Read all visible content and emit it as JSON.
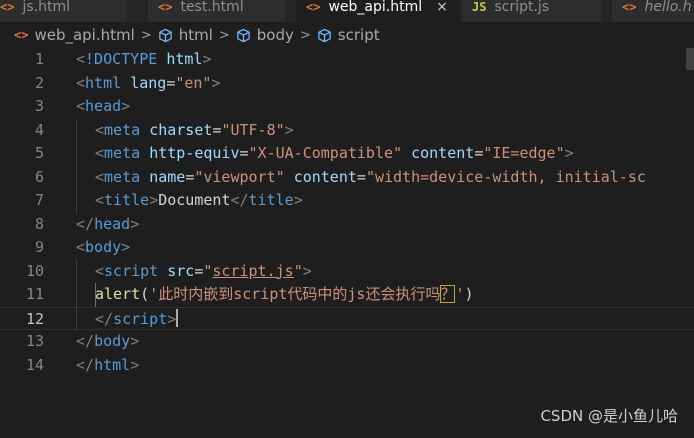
{
  "tabs": [
    {
      "icon": "<>",
      "label": "js.html"
    },
    {
      "icon": "<>",
      "label": "test.html"
    },
    {
      "icon": "<>",
      "label": "web_api.html",
      "close": "×"
    },
    {
      "icon": "JS",
      "label": "script.js"
    },
    {
      "icon": "<>",
      "label": "hello.h"
    }
  ],
  "breadcrumb": {
    "file": "web_api.html",
    "items": [
      "html",
      "body",
      "script"
    ],
    "separator": ">"
  },
  "editor": {
    "line_numbers": [
      "1",
      "2",
      "3",
      "4",
      "5",
      "6",
      "7",
      "8",
      "9",
      "10",
      "11",
      "12",
      "13",
      "14"
    ],
    "current_line": "12",
    "lines": [
      [
        [
          "punc",
          "<"
        ],
        [
          "tag",
          "!DOCTYPE"
        ],
        [
          "txt",
          " "
        ],
        [
          "attr",
          "html"
        ],
        [
          "punc",
          ">"
        ]
      ],
      [
        [
          "punc",
          "<"
        ],
        [
          "tag",
          "html"
        ],
        [
          "txt",
          " "
        ],
        [
          "attr",
          "lang"
        ],
        [
          "txt",
          "="
        ],
        [
          "str",
          "\"en\""
        ],
        [
          "punc",
          ">"
        ]
      ],
      [
        [
          "punc",
          "<"
        ],
        [
          "tag",
          "head"
        ],
        [
          "punc",
          ">"
        ]
      ],
      [
        [
          "punc",
          "<"
        ],
        [
          "tag",
          "meta"
        ],
        [
          "txt",
          " "
        ],
        [
          "attr",
          "charset"
        ],
        [
          "txt",
          "="
        ],
        [
          "str",
          "\"UTF-8\""
        ],
        [
          "punc",
          ">"
        ]
      ],
      [
        [
          "punc",
          "<"
        ],
        [
          "tag",
          "meta"
        ],
        [
          "txt",
          " "
        ],
        [
          "attr",
          "http-equiv"
        ],
        [
          "txt",
          "="
        ],
        [
          "str",
          "\"X-UA-Compatible\""
        ],
        [
          "txt",
          " "
        ],
        [
          "attr",
          "content"
        ],
        [
          "txt",
          "="
        ],
        [
          "str",
          "\"IE=edge\""
        ],
        [
          "punc",
          ">"
        ]
      ],
      [
        [
          "punc",
          "<"
        ],
        [
          "tag",
          "meta"
        ],
        [
          "txt",
          " "
        ],
        [
          "attr",
          "name"
        ],
        [
          "txt",
          "="
        ],
        [
          "str",
          "\"viewport\""
        ],
        [
          "txt",
          " "
        ],
        [
          "attr",
          "content"
        ],
        [
          "txt",
          "="
        ],
        [
          "str",
          "\"width=device-width, initial-sc"
        ]
      ],
      [
        [
          "punc",
          "<"
        ],
        [
          "tag",
          "title"
        ],
        [
          "punc",
          ">"
        ],
        [
          "txt",
          "Document"
        ],
        [
          "punc",
          "</"
        ],
        [
          "tag",
          "title"
        ],
        [
          "punc",
          ">"
        ]
      ],
      [
        [
          "punc",
          "</"
        ],
        [
          "tag",
          "head"
        ],
        [
          "punc",
          ">"
        ]
      ],
      [
        [
          "punc",
          "<"
        ],
        [
          "tag",
          "body"
        ],
        [
          "punc",
          ">"
        ]
      ],
      [
        [
          "punc",
          "<"
        ],
        [
          "tag",
          "script"
        ],
        [
          "txt",
          " "
        ],
        [
          "attr",
          "src"
        ],
        [
          "txt",
          "="
        ],
        [
          "str",
          "\""
        ],
        [
          "str link",
          "script.js"
        ],
        [
          "str",
          "\""
        ],
        [
          "punc",
          ">"
        ]
      ],
      [
        [
          "fn",
          "alert"
        ],
        [
          "txt",
          "("
        ],
        [
          "str",
          "'此时内嵌到script代码中的js还会执行吗"
        ],
        [
          "str hl",
          "？"
        ],
        [
          "str",
          "'"
        ],
        [
          "txt",
          ")"
        ]
      ],
      [
        [
          "punc",
          "</"
        ],
        [
          "tag",
          "script"
        ],
        [
          "punc",
          ">"
        ]
      ],
      [
        [
          "punc",
          "</"
        ],
        [
          "tag",
          "body"
        ],
        [
          "punc",
          ">"
        ]
      ],
      [
        [
          "punc",
          "</"
        ],
        [
          "tag",
          "html"
        ],
        [
          "punc",
          ">"
        ]
      ]
    ]
  },
  "watermark": "CSDN @是小鱼儿哈",
  "colors": {
    "background": "#1e1e1e",
    "tag": "#569cd6",
    "attribute": "#9cdcfe",
    "string": "#ce9178",
    "function": "#dcdcaa",
    "punctuation": "#808080",
    "html_icon": "#e37933",
    "js_icon": "#cbcb41"
  },
  "icons": {
    "breadcrumb_symbol": "cube-icon",
    "file": "html-file-icon"
  }
}
